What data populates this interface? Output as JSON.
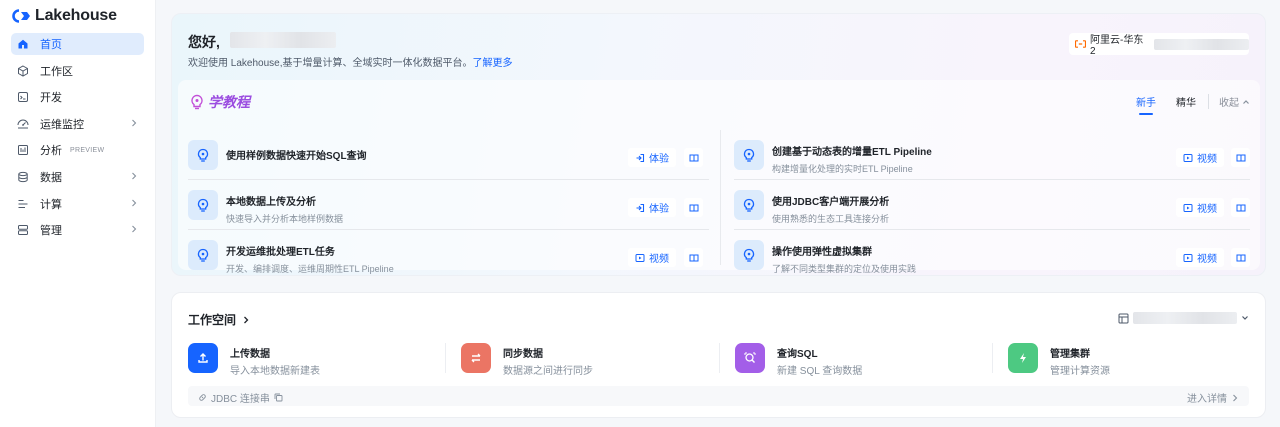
{
  "app": {
    "logo_text": "Lakehouse",
    "brand_color": "#1664ff"
  },
  "sidebar": {
    "items": [
      {
        "label": "首页",
        "icon": "home-icon",
        "active": true
      },
      {
        "label": "工作区",
        "icon": "cube-icon"
      },
      {
        "label": "开发",
        "icon": "code-icon"
      },
      {
        "label": "运维监控",
        "icon": "monitor-icon",
        "expandable": true
      },
      {
        "label": "分析",
        "icon": "analysis-icon",
        "badge": "PREVIEW"
      },
      {
        "label": "数据",
        "icon": "database-icon",
        "expandable": true
      },
      {
        "label": "计算",
        "icon": "compute-icon",
        "expandable": true
      },
      {
        "label": "管理",
        "icon": "manage-icon",
        "expandable": true
      }
    ]
  },
  "header": {
    "greeting": "您好,",
    "welcome_text": "欢迎使用 Lakehouse,基于增量计算、全域实时一体化数据平台。",
    "learn_more": "了解更多",
    "region": "阿里云-华东2"
  },
  "tutorials": {
    "title": "学教程",
    "tabs": [
      {
        "label": "新手",
        "active": true
      },
      {
        "label": "精华"
      }
    ],
    "collapse_label": "收起",
    "items": [
      {
        "title": "使用样例数据快速开始SQL查询",
        "subtitle": "",
        "action": "体验",
        "action_icon": "enter-icon"
      },
      {
        "title": "创建基于动态表的增量ETL Pipeline",
        "subtitle": "构建增量化处理的实时ETL Pipeline",
        "action": "视频",
        "action_icon": "play-icon"
      },
      {
        "title": "本地数据上传及分析",
        "subtitle": "快速导入并分析本地样例数据",
        "action": "体验",
        "action_icon": "enter-icon"
      },
      {
        "title": "使用JDBC客户端开展分析",
        "subtitle": "使用熟悉的生态工具连接分析",
        "action": "视频",
        "action_icon": "play-icon"
      },
      {
        "title": "开发运维批处理ETL任务",
        "subtitle": "开发、编排调度、运维周期性ETL Pipeline",
        "action": "视频",
        "action_icon": "play-icon"
      },
      {
        "title": "操作使用弹性虚拟集群",
        "subtitle": "了解不同类型集群的定位及使用实践",
        "action": "视频",
        "action_icon": "play-icon"
      }
    ]
  },
  "workspace": {
    "title": "工作空间",
    "actions": [
      {
        "title": "上传数据",
        "subtitle": "导入本地数据新建表",
        "color": "#1664ff",
        "icon": "upload-icon"
      },
      {
        "title": "同步数据",
        "subtitle": "数据源之间进行同步",
        "color": "#eb7564",
        "icon": "sync-icon"
      },
      {
        "title": "查询SQL",
        "subtitle": "新建 SQL 查询数据",
        "color": "#a35ee8",
        "icon": "sql-query-icon"
      },
      {
        "title": "管理集群",
        "subtitle": "管理计算资源",
        "color": "#4dc982",
        "icon": "lightning-icon"
      }
    ],
    "jdbc_label": "JDBC 连接串",
    "detail_label": "进入详情"
  }
}
